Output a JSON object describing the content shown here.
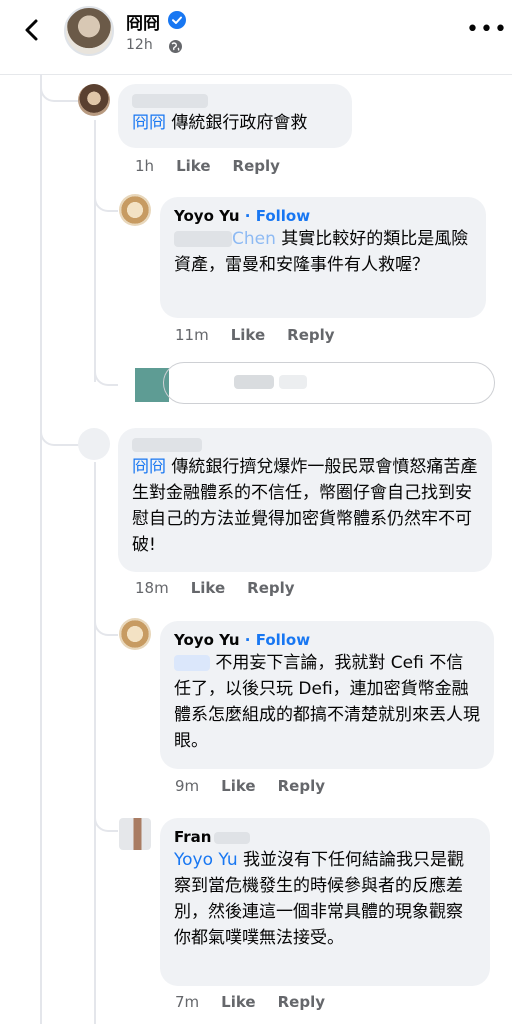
{
  "header": {
    "name": "冏冏",
    "time": "12h"
  },
  "comments": [
    {
      "mention": "冏冏",
      "text": "傳統銀行政府會救",
      "time": "1h",
      "like": "Like",
      "reply": "Reply"
    },
    {
      "name": "Yoyo Yu",
      "follow": "· Follow",
      "mention_tail": "Chen",
      "text": " 其實比較好的類比是風險資產，雷曼和安隆事件有人救喔？",
      "time": "11m",
      "like": "Like",
      "reply": "Reply"
    },
    {
      "mention": "冏冏",
      "text": " 傳統銀行擠兌爆炸一般民眾會憤怒痛苦產生對金融體系的不信任，幣圈仔會自己找到安慰自己的方法並覺得加密貨幣體系仍然牢不可破!",
      "time": "18m",
      "like": "Like",
      "reply": "Reply"
    },
    {
      "name": "Yoyo Yu",
      "follow": "· Follow",
      "text": " 不用妄下言論，我就對 Cefi 不信任了，以後只玩 Defi，連加密貨幣金融體系怎麼組成的都搞不清楚就別來丟人現眼。",
      "time": "9m",
      "like": "Like",
      "reply": "Reply"
    },
    {
      "name": "Fran",
      "mention": "Yoyo Yu",
      "text": " 我並沒有下任何結論我只是觀察到當危機發生的時候參與者的反應差別，然後連這一個非常具體的現象觀察你都氣噗噗無法接受。",
      "time": "7m",
      "like": "Like",
      "reply": "Reply"
    }
  ],
  "colors": {
    "accent": "#1877f2",
    "bubble": "#f0f2f5",
    "muted": "#65676b"
  }
}
